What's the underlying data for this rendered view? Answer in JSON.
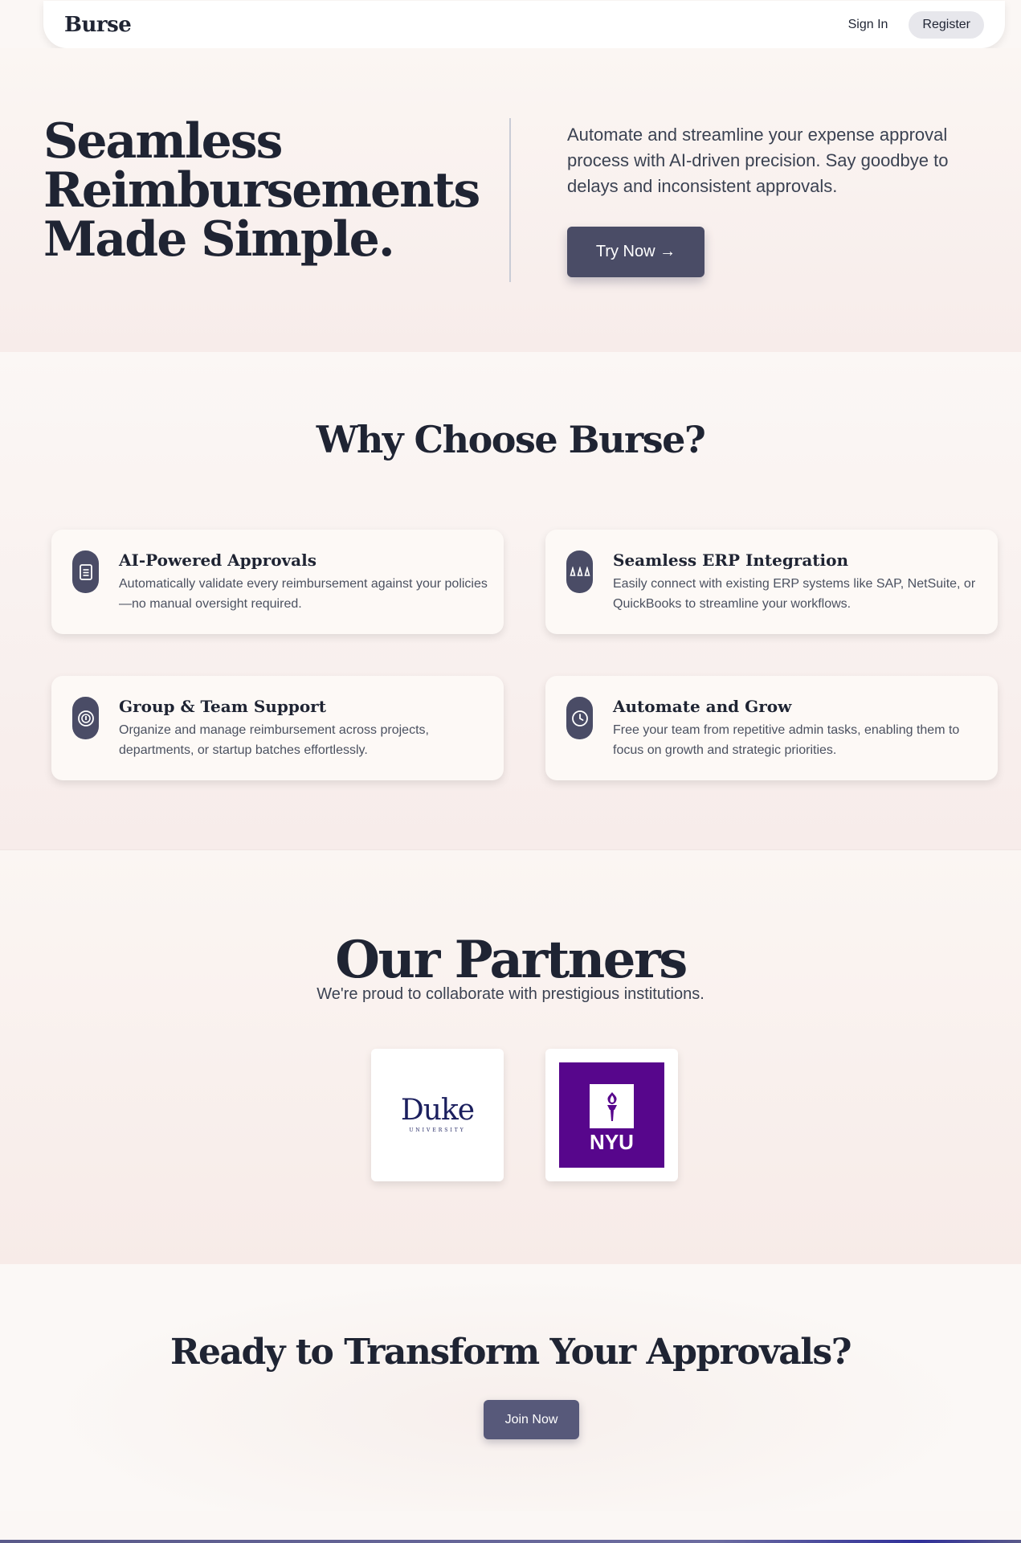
{
  "nav": {
    "brand": "Burse",
    "signin_label": "Sign In",
    "register_label": "Register"
  },
  "hero": {
    "title_line1": "Seamless",
    "title_line2": "Reimbursements",
    "title_line3": "Made Simple.",
    "description": "Automate and streamline your expense approval process with AI-driven precision. Say goodbye to delays and inconsistent approvals.",
    "cta_label": "Try Now →"
  },
  "features": {
    "title": "Why Choose Burse?",
    "items": [
      {
        "icon": "document-icon",
        "title": "AI-Powered Approvals",
        "text": "Automatically validate every reimbursement against your policies—no manual oversight required."
      },
      {
        "icon": "integration-icon",
        "title": "Seamless ERP Integration",
        "text": "Easily connect with existing ERP systems like SAP, NetSuite, or QuickBooks to streamline your workflows."
      },
      {
        "icon": "team-icon",
        "title": "Group & Team Support",
        "text": "Organize and manage reimbursement across projects, departments, or startup batches effortlessly."
      },
      {
        "icon": "clock-icon",
        "title": "Automate and Grow",
        "text": "Free your team from repetitive admin tasks, enabling them to focus on growth and strategic priorities."
      }
    ]
  },
  "partners": {
    "title": "Our Partners",
    "subtitle": "We're proud to collaborate with prestigious institutions.",
    "logos": [
      {
        "name": "Duke",
        "sub": "UNIVERSITY",
        "color": "#1b1f5e"
      },
      {
        "name": "NYU",
        "color": "#57068c"
      }
    ]
  },
  "cta": {
    "title": "Ready to Transform Your Approvals?",
    "button_label": "Join Now"
  },
  "colors": {
    "primary": "#4a4c66",
    "text": "#1f2433",
    "background": "#fbf7f5"
  }
}
